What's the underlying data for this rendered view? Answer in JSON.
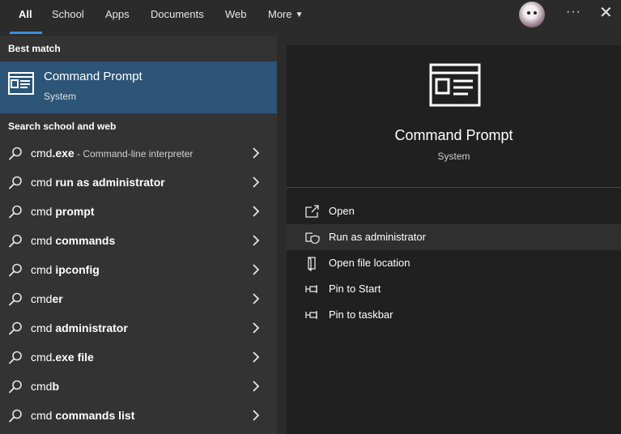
{
  "tabs": [
    {
      "label": "All"
    },
    {
      "label": "School"
    },
    {
      "label": "Apps"
    },
    {
      "label": "Documents"
    },
    {
      "label": "Web"
    },
    {
      "label": "More"
    }
  ],
  "header": {
    "ellipsis": "···"
  },
  "best_match": {
    "heading": "Best match",
    "app_name": "Command Prompt",
    "app_type": "System"
  },
  "search_section": {
    "heading": "Search school and web",
    "results": [
      {
        "prefix": "cmd",
        "bold": ".exe",
        "desc": " - Command-line interpreter"
      },
      {
        "prefix": "cmd ",
        "bold": "run as administrator",
        "desc": ""
      },
      {
        "prefix": "cmd ",
        "bold": "prompt",
        "desc": ""
      },
      {
        "prefix": "cmd ",
        "bold": "commands",
        "desc": ""
      },
      {
        "prefix": "cmd ",
        "bold": "ipconfig",
        "desc": ""
      },
      {
        "prefix": "cmd",
        "bold": "er",
        "desc": ""
      },
      {
        "prefix": "cmd ",
        "bold": "administrator",
        "desc": ""
      },
      {
        "prefix": "cmd",
        "bold": ".exe file",
        "desc": ""
      },
      {
        "prefix": "cmd",
        "bold": "b",
        "desc": ""
      },
      {
        "prefix": "cmd ",
        "bold": "commands list",
        "desc": ""
      }
    ]
  },
  "detail": {
    "app_name": "Command Prompt",
    "app_type": "System",
    "actions": [
      {
        "label": "Open",
        "icon": "open-icon"
      },
      {
        "label": "Run as administrator",
        "icon": "shield-icon"
      },
      {
        "label": "Open file location",
        "icon": "file-location-icon"
      },
      {
        "label": "Pin to Start",
        "icon": "pin-icon"
      },
      {
        "label": "Pin to taskbar",
        "icon": "pin-icon"
      }
    ]
  },
  "colors": {
    "accent": "#3a8fd9",
    "best_match_bg": "#2c5577",
    "left_panel_bg": "#333333",
    "right_panel_bg": "#202020"
  }
}
